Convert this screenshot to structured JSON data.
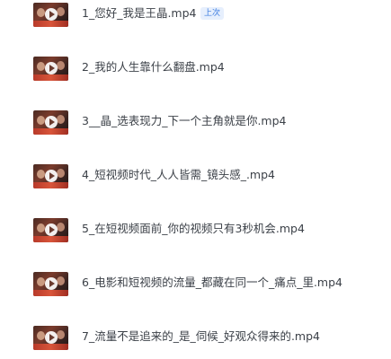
{
  "files": [
    {
      "name": "1_您好_我是王晶.mp4",
      "badge": "上次",
      "icon": "video-thumbnail-icon"
    },
    {
      "name": "2_我的人生靠什么翻盘.mp4",
      "icon": "video-thumbnail-icon"
    },
    {
      "name": "3__晶_选表现力_下一个主角就是你.mp4",
      "icon": "video-thumbnail-icon"
    },
    {
      "name": "4_短视频时代_人人皆需_镜头感_.mp4",
      "icon": "video-thumbnail-icon"
    },
    {
      "name": "5_在短视频面前_你的视频只有3秒机会.mp4",
      "icon": "video-thumbnail-icon"
    },
    {
      "name": "6_电影和短视频的流量_都藏在同一个_痛点_里.mp4",
      "icon": "video-thumbnail-icon"
    },
    {
      "name": "7_流量不是追来的_是_伺候_好观众得来的.mp4",
      "icon": "video-thumbnail-icon"
    }
  ],
  "colors": {
    "text": "#3c4148",
    "badge_text": "#3a7be0",
    "badge_bg": "#e6effd"
  }
}
